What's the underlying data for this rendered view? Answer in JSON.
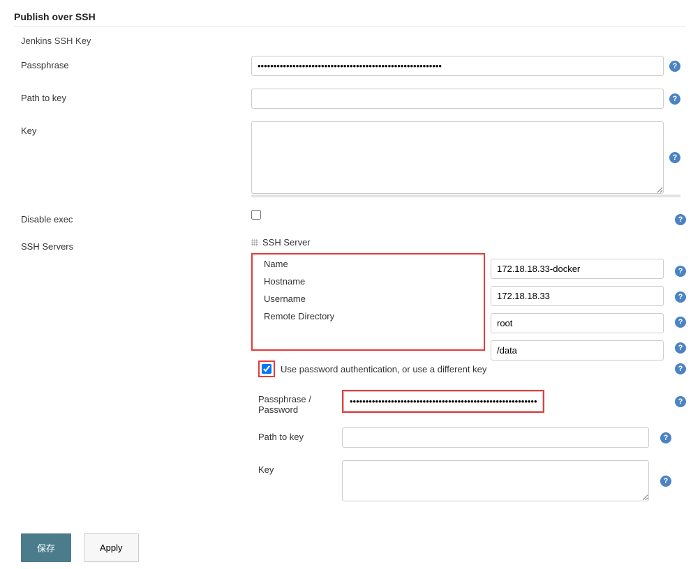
{
  "section": {
    "title": "Publish over SSH",
    "subsection": "Jenkins SSH Key"
  },
  "labels": {
    "passphrase": "Passphrase",
    "path_to_key": "Path to key",
    "key": "Key",
    "disable_exec": "Disable exec",
    "ssh_servers": "SSH Servers",
    "ssh_server_heading": "SSH Server",
    "name": "Name",
    "hostname": "Hostname",
    "username": "Username",
    "remote_directory": "Remote Directory",
    "use_password_auth": "Use password authentication, or use a different key",
    "passphrase_password": "Passphrase / Password"
  },
  "values": {
    "main_passphrase": "••••••••••••••••••••••••••••••••••••••••••••••••••••••••••",
    "main_path_to_key": "",
    "main_key": "",
    "disable_exec_checked": false,
    "server_name": "172.18.18.33-docker",
    "server_hostname": "172.18.18.33",
    "server_username": "root",
    "server_remote_dir": "/data",
    "use_password_auth_checked": true,
    "server_passphrase": "••••••••••••••••••••••••••••••••••••••••••••••••••••••••••••",
    "server_path_to_key": "",
    "server_key": ""
  },
  "buttons": {
    "save": "保存",
    "apply": "Apply"
  },
  "help_glyph": "?"
}
